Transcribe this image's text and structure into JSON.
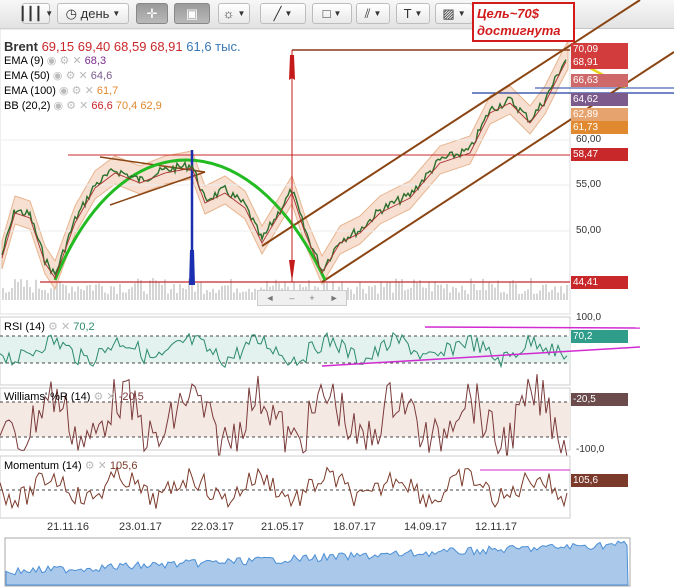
{
  "toolbar": {
    "period_label": "день",
    "tools": [
      "bars-icon",
      "clock-icon",
      "crosshair-icon",
      "chart-frame-icon",
      "sun-icon",
      "line-tool-icon",
      "shape-tool-icon",
      "fib-tool-icon",
      "text-tool-icon",
      "image-tool-icon"
    ],
    "text_tool": "T"
  },
  "annotation": {
    "line1": "Цель~70$",
    "line2": "достигнута"
  },
  "main": {
    "symbol": "Brent",
    "open": "69,15",
    "high": "69,40",
    "low": "68,59",
    "close": "68,91",
    "volume": "61,6 тыс.",
    "ema9_label": "EMA (9)",
    "ema9_value": "68,3",
    "ema50_label": "EMA (50)",
    "ema50_value": "64,6",
    "ema100_label": "EMA (100)",
    "ema100_value": "61,7",
    "bb_label": "BB (20,2)",
    "bb_mid": "66,6",
    "bb_up": "70,4",
    "bb_low": "62,9",
    "price_tags": [
      {
        "text": "70,09",
        "color": "#d23c3c"
      },
      {
        "text": "68,91",
        "color": "#d23c3c"
      },
      {
        "text": "66,63",
        "color": "#cf6868"
      },
      {
        "text": "64,62",
        "color": "#7c5b8c"
      },
      {
        "text": "62,89",
        "color": "#e6a36e"
      },
      {
        "text": "61,73",
        "color": "#e0892f"
      },
      {
        "text": "58,47",
        "color": "#c8282a"
      },
      {
        "text": "44,41",
        "color": "#c8282a"
      }
    ],
    "ticks": [
      "60,00",
      "55,00",
      "50,00"
    ]
  },
  "rsi": {
    "label": "RSI (14)",
    "value": "70,2",
    "top": "100,0",
    "tag": "70,2",
    "tag_color": "#2f9d8a"
  },
  "williams": {
    "label": "Williams' %R (14)",
    "value": "-20,5",
    "tag": "-20,5",
    "bottom": "-100,0",
    "tag_color": "#6b4b4b"
  },
  "momentum": {
    "label": "Momentum (14)",
    "value": "105,6",
    "tag": "105,6",
    "tag_color": "#7b3a2a"
  },
  "xaxis": [
    "21.11.16",
    "23.01.17",
    "22.03.17",
    "21.05.17",
    "18.07.17",
    "14.09.17",
    "12.11.17"
  ],
  "nav": [
    "◄",
    "–",
    "+",
    "►"
  ],
  "chart_data": {
    "type": "line",
    "title": "Brent",
    "x": [
      "21.11.16",
      "23.01.17",
      "22.03.17",
      "21.05.17",
      "18.07.17",
      "14.09.17",
      "12.11.17"
    ],
    "series": [
      {
        "name": "Brent",
        "values": [
          47.5,
          55.0,
          51.5,
          52.0,
          49.0,
          56.5,
          63.5
        ]
      }
    ],
    "ylim": [
      43,
      71
    ]
  }
}
